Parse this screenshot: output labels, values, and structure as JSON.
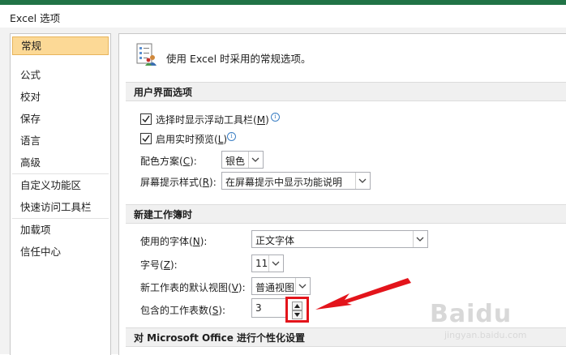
{
  "window": {
    "title": "Excel 选项"
  },
  "sidebar": {
    "items": [
      {
        "label": "常规",
        "selected": true
      },
      {
        "label": "公式"
      },
      {
        "label": "校对"
      },
      {
        "label": "保存"
      },
      {
        "label": "语言"
      },
      {
        "label": "高级"
      },
      {
        "label": "自定义功能区"
      },
      {
        "label": "快速访问工具栏"
      },
      {
        "label": "加载项"
      },
      {
        "label": "信任中心"
      }
    ]
  },
  "general": {
    "header": "使用 Excel 时采用的常规选项。",
    "ui_section": "用户界面选项",
    "mini_toolbar_label": "选择时显示浮动工具栏",
    "mini_toolbar_key": "M",
    "mini_toolbar_checked": true,
    "live_preview_label": "启用实时预览",
    "live_preview_key": "L",
    "live_preview_checked": true,
    "color_scheme_label": "配色方案",
    "color_scheme_key": "C",
    "color_scheme_value": "银色",
    "screentip_label": "屏幕提示样式",
    "screentip_key": "R",
    "screentip_value": "在屏幕提示中显示功能说明",
    "new_wb_section": "新建工作簿时",
    "font_label": "使用的字体",
    "font_key": "N",
    "font_value": "正文字体",
    "size_label": "字号",
    "size_key": "Z",
    "size_value": "11",
    "view_label": "新工作表的默认视图",
    "view_key": "V",
    "view_value": "普通视图",
    "sheets_label": "包含的工作表数",
    "sheets_key": "S",
    "sheets_value": "3",
    "personalize_section": "对 Microsoft Office 进行个性化设置"
  },
  "watermark": {
    "logo": "Baidu",
    "sub": "jingyan.baidu.com"
  },
  "colors": {
    "accent": "#217346",
    "selected_bg": "#fcd996",
    "highlight": "#e3141b"
  }
}
